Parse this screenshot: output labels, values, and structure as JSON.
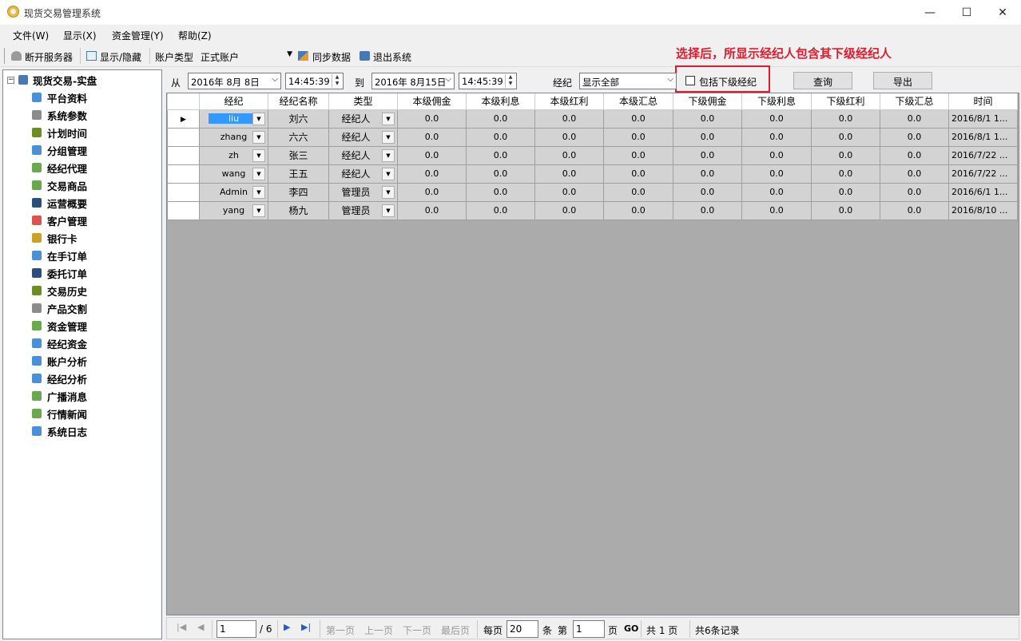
{
  "window": {
    "title": "现货交易管理系统",
    "min": "—",
    "max": "☐",
    "close": "✕"
  },
  "menu": [
    "文件(W)",
    "显示(X)",
    "资金管理(Y)",
    "帮助(Z)"
  ],
  "toolbar": {
    "disconnect": "断开服务器",
    "toggle": "显示/隐藏",
    "account_type_label": "账户类型",
    "account_type_value": "正式账户",
    "sync": "同步数据",
    "exit": "退出系统"
  },
  "tree": {
    "root": "现货交易-实盘",
    "items": [
      "平台资料",
      "系统参数",
      "计划时间",
      "分组管理",
      "经纪代理",
      "交易商品",
      "运营概要",
      "客户管理",
      "银行卡",
      "在手订单",
      "委托订单",
      "交易历史",
      "产品交割",
      "资金管理",
      "经纪资金",
      "账户分析",
      "经纪分析",
      "广播消息",
      "行情新闻",
      "系统日志"
    ],
    "icon_colors": [
      "#4a90d9",
      "#8c8c8c",
      "#6b8e23",
      "#4a90d9",
      "#6aa84f",
      "#6aa84f",
      "#2b4f7a",
      "#d9534f",
      "#c9a227",
      "#4a90d9",
      "#2b4f7a",
      "#6b8e23",
      "#8c8c8c",
      "#6aa84f",
      "#4a90d9",
      "#4a90d9",
      "#4a90d9",
      "#6aa84f",
      "#6aa84f",
      "#4a90d9"
    ]
  },
  "filter": {
    "from_label": "从",
    "from_date": "2016年 8月 8日",
    "from_time": "14:45:39",
    "to_label": "到",
    "to_date": "2016年 8月15日",
    "to_time": "14:45:39",
    "broker_label": "经纪",
    "broker_value": "显示全部",
    "include_sub": "包括下级经纪",
    "query": "查询",
    "export": "导出"
  },
  "annotation": "选择后，所显示经纪人包含其下级经纪人",
  "grid": {
    "columns": [
      "经纪",
      "经纪名称",
      "类型",
      "本级佣金",
      "本级利息",
      "本级红利",
      "本级汇总",
      "下级佣金",
      "下级利息",
      "下级红利",
      "下级汇总",
      "时间"
    ],
    "rows": [
      {
        "id": "liu",
        "name": "刘六",
        "type": "经纪人",
        "v": [
          "0.0",
          "0.0",
          "0.0",
          "0.0",
          "0.0",
          "0.0",
          "0.0",
          "0.0"
        ],
        "time": "2016/8/1 1..."
      },
      {
        "id": "zhang",
        "name": "六六",
        "type": "经纪人",
        "v": [
          "0.0",
          "0.0",
          "0.0",
          "0.0",
          "0.0",
          "0.0",
          "0.0",
          "0.0"
        ],
        "time": "2016/8/1 1..."
      },
      {
        "id": "zh",
        "name": "张三",
        "type": "经纪人",
        "v": [
          "0.0",
          "0.0",
          "0.0",
          "0.0",
          "0.0",
          "0.0",
          "0.0",
          "0.0"
        ],
        "time": "2016/7/22 ..."
      },
      {
        "id": "wang",
        "name": "王五",
        "type": "经纪人",
        "v": [
          "0.0",
          "0.0",
          "0.0",
          "0.0",
          "0.0",
          "0.0",
          "0.0",
          "0.0"
        ],
        "time": "2016/7/22 ..."
      },
      {
        "id": "Admin",
        "name": "李四",
        "type": "管理员",
        "v": [
          "0.0",
          "0.0",
          "0.0",
          "0.0",
          "0.0",
          "0.0",
          "0.0",
          "0.0"
        ],
        "time": "2016/6/1 1..."
      },
      {
        "id": "yang",
        "name": "杨九",
        "type": "管理员",
        "v": [
          "0.0",
          "0.0",
          "0.0",
          "0.0",
          "0.0",
          "0.0",
          "0.0",
          "0.0"
        ],
        "time": "2016/8/10 ..."
      }
    ]
  },
  "pager": {
    "page": "1",
    "total": "/ 6",
    "first": "第一页",
    "prev": "上一页",
    "next": "下一页",
    "last": "最后页",
    "per_page_label": "每页",
    "per_page": "20",
    "unit": "条",
    "goto_label": "第",
    "goto_page": "1",
    "page_unit": "页",
    "go": "GO",
    "total_pages": "共 1 页",
    "records": "共6条记录"
  },
  "colors": {
    "accent": "#3399ff",
    "annotation": "#e8192c"
  }
}
